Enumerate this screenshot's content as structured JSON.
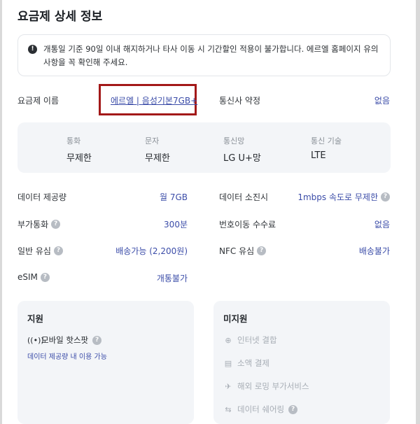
{
  "page": {
    "title": "요금제 상세 정보"
  },
  "notice": {
    "text": "개통일 기준 90일 이내 해지하거나 타사 이동 시 기간할인 적용이 불가합니다. 에르엘 홈페이지 유의사항을 꼭 확인해 주세요."
  },
  "plan": {
    "label": "요금제 이름",
    "name": "에르엘 | 음성기본7GB+"
  },
  "contract": {
    "label": "통신사 약정",
    "value": "없음"
  },
  "specs": [
    {
      "key": "통화",
      "value": "무제한"
    },
    {
      "key": "문자",
      "value": "무제한"
    },
    {
      "key": "통신망",
      "value": "LG U+망"
    },
    {
      "key": "통신 기술",
      "value": "LTE"
    }
  ],
  "details": {
    "data_amount": {
      "label": "데이터 제공량",
      "value": "월 7GB"
    },
    "data_exhausted": {
      "label": "데이터 소진시",
      "value": "1mbps 속도로 무제한"
    },
    "extra_call": {
      "label": "부가통화",
      "value": "300분"
    },
    "port_fee": {
      "label": "번호이동 수수료",
      "value": "없음"
    },
    "usim": {
      "label": "일반 유심",
      "value": "배송가능 (2,200원)"
    },
    "nfc_usim": {
      "label": "NFC 유심",
      "value": "배송불가"
    },
    "esim": {
      "label": "eSIM",
      "value": "개통불가"
    }
  },
  "supported": {
    "title": "지원",
    "items": [
      {
        "icon": "hotspot-icon",
        "label": "모바일 핫스팟",
        "note": "데이터 제공량 내 이용 가능"
      }
    ]
  },
  "unsupported": {
    "title": "미지원",
    "items": [
      {
        "icon": "globe-icon",
        "label": "인터넷 결합"
      },
      {
        "icon": "receipt-icon",
        "label": "소액 결제"
      },
      {
        "icon": "plane-icon",
        "label": "해외 로밍 부가서비스"
      },
      {
        "icon": "share-icon",
        "label": "데이터 쉐어링"
      }
    ]
  },
  "colors": {
    "accent": "#3b4ca8",
    "highlight_border": "#a31919",
    "muted": "#a7adb5"
  }
}
